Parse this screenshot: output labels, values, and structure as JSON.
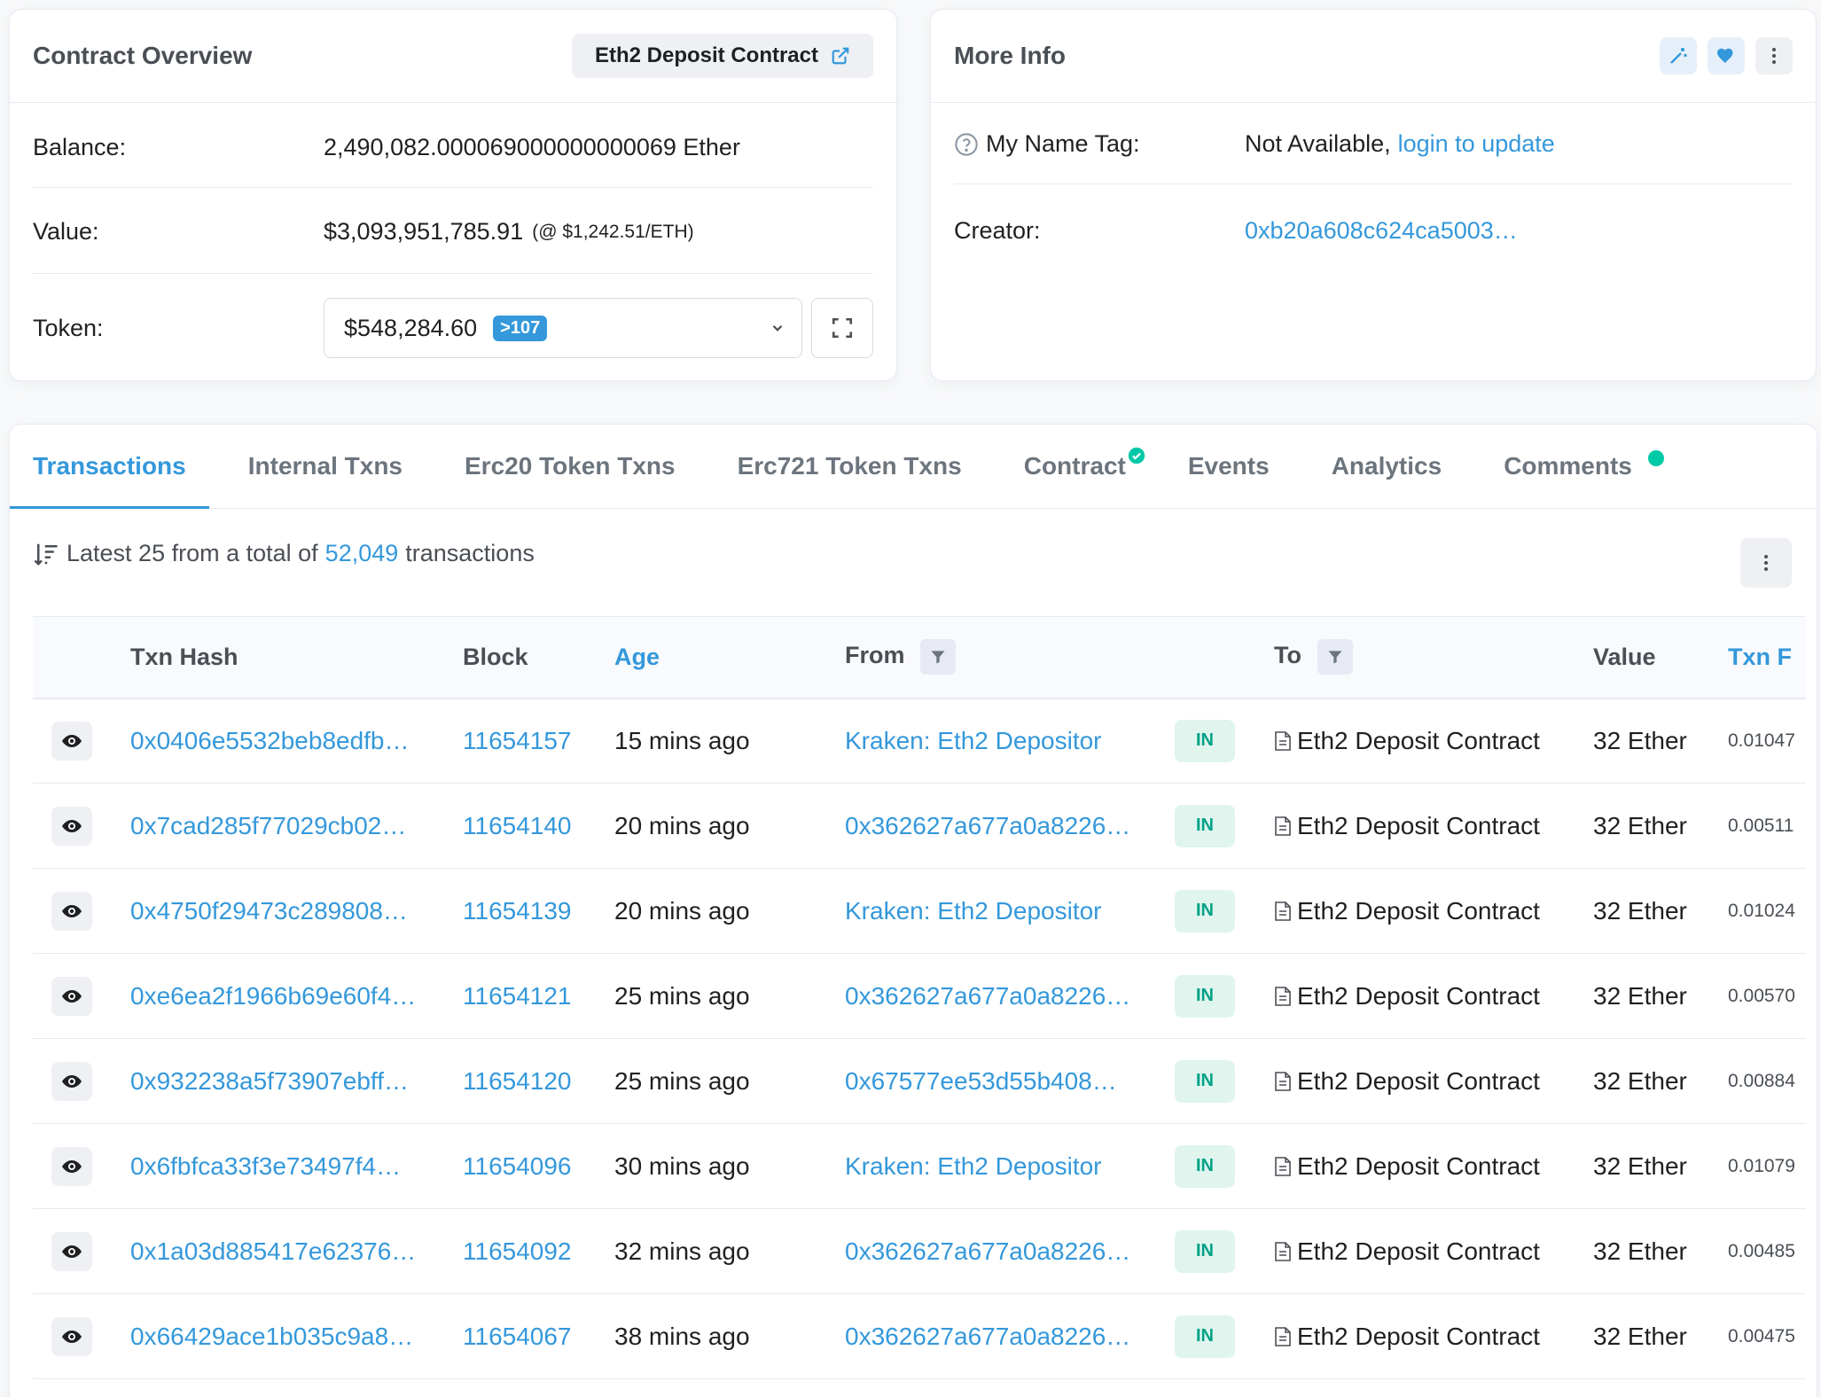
{
  "overview": {
    "title": "Contract Overview",
    "contract_button": "Eth2 Deposit Contract",
    "balance_label": "Balance:",
    "balance_value": "2,490,082.000069000000000069 Ether",
    "value_label": "Value:",
    "value_amount": "$3,093,951,785.91",
    "value_rate": "(@ $1,242.51/ETH)",
    "token_label": "Token:",
    "token_value": "$548,284.60",
    "token_count": ">107"
  },
  "more_info": {
    "title": "More Info",
    "name_tag_label": "My Name Tag:",
    "name_tag_value": "Not Available,",
    "name_tag_link": "login to update",
    "creator_label": "Creator:",
    "creator_value": "0xb20a608c624ca5003…"
  },
  "tabs": [
    {
      "label": "Transactions"
    },
    {
      "label": "Internal Txns"
    },
    {
      "label": "Erc20 Token Txns"
    },
    {
      "label": "Erc721 Token Txns"
    },
    {
      "label": "Contract"
    },
    {
      "label": "Events"
    },
    {
      "label": "Analytics"
    },
    {
      "label": "Comments"
    }
  ],
  "summary": {
    "prefix": "Latest 25 from a total of",
    "count": "52,049",
    "suffix": "transactions"
  },
  "table": {
    "headers": {
      "txn_hash": "Txn Hash",
      "block": "Block",
      "age": "Age",
      "from": "From",
      "to": "To",
      "value": "Value",
      "fee": "Txn F"
    },
    "rows": [
      {
        "hash": "0x0406e5532beb8edfb…",
        "block": "11654157",
        "age": "15 mins ago",
        "from": "Kraken: Eth2 Depositor",
        "dir": "IN",
        "to": "Eth2 Deposit Contract",
        "value": "32 Ether",
        "fee": "0.01047"
      },
      {
        "hash": "0x7cad285f77029cb02…",
        "block": "11654140",
        "age": "20 mins ago",
        "from": "0x362627a677a0a8226…",
        "dir": "IN",
        "to": "Eth2 Deposit Contract",
        "value": "32 Ether",
        "fee": "0.00511"
      },
      {
        "hash": "0x4750f29473c289808…",
        "block": "11654139",
        "age": "20 mins ago",
        "from": "Kraken: Eth2 Depositor",
        "dir": "IN",
        "to": "Eth2 Deposit Contract",
        "value": "32 Ether",
        "fee": "0.01024"
      },
      {
        "hash": "0xe6ea2f1966b69e60f4…",
        "block": "11654121",
        "age": "25 mins ago",
        "from": "0x362627a677a0a8226…",
        "dir": "IN",
        "to": "Eth2 Deposit Contract",
        "value": "32 Ether",
        "fee": "0.00570"
      },
      {
        "hash": "0x932238a5f73907ebff…",
        "block": "11654120",
        "age": "25 mins ago",
        "from": "0x67577ee53d55b408…",
        "dir": "IN",
        "to": "Eth2 Deposit Contract",
        "value": "32 Ether",
        "fee": "0.00884"
      },
      {
        "hash": "0x6fbfca33f3e73497f4…",
        "block": "11654096",
        "age": "30 mins ago",
        "from": "Kraken: Eth2 Depositor",
        "dir": "IN",
        "to": "Eth2 Deposit Contract",
        "value": "32 Ether",
        "fee": "0.01079"
      },
      {
        "hash": "0x1a03d885417e62376…",
        "block": "11654092",
        "age": "32 mins ago",
        "from": "0x362627a677a0a8226…",
        "dir": "IN",
        "to": "Eth2 Deposit Contract",
        "value": "32 Ether",
        "fee": "0.00485"
      },
      {
        "hash": "0x66429ace1b035c9a8…",
        "block": "11654067",
        "age": "38 mins ago",
        "from": "0x362627a677a0a8226…",
        "dir": "IN",
        "to": "Eth2 Deposit Contract",
        "value": "32 Ether",
        "fee": "0.00475"
      }
    ]
  },
  "colors": {
    "accent": "#3498db",
    "success": "#00c9a7",
    "in_badge_bg": "#dff5ee",
    "in_badge_text": "#00a186"
  },
  "icons": [
    "external-link-icon",
    "chevron-down-icon",
    "expand-icon",
    "magic-wand-icon",
    "heart-icon",
    "dots-vertical-icon",
    "help-circle-icon",
    "check-badge-icon",
    "sort-icon",
    "eye-icon",
    "filter-icon",
    "document-icon"
  ]
}
